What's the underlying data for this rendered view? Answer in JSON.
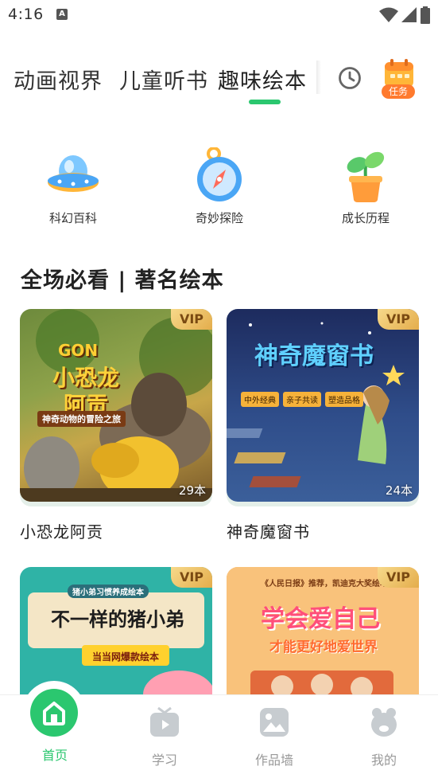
{
  "status_bar": {
    "time": "4:16",
    "notification_icon": "A"
  },
  "top_tabs": {
    "items": [
      {
        "label": "动画视界"
      },
      {
        "label": "儿童听书"
      },
      {
        "label": "趣味绘本"
      }
    ],
    "active_index": 2,
    "history_icon": "clock-icon",
    "task_label": "任务"
  },
  "categories": [
    {
      "label": "科幻百科",
      "icon": "ufo-icon"
    },
    {
      "label": "奇妙探险",
      "icon": "compass-icon"
    },
    {
      "label": "成长历程",
      "icon": "sprout-icon"
    }
  ],
  "section_title": "全场必看 | 著名绘本",
  "cards": [
    {
      "title": "小恐龙阿贡",
      "badge": "VIP",
      "count": "29本",
      "cover_title": "小恐龙阿贡",
      "cover_brand": "GON",
      "cover_sub": "神奇动物的冒险之旅"
    },
    {
      "title": "神奇魔窗书",
      "badge": "VIP",
      "count": "24本",
      "cover_title": "神奇魔窗书",
      "cover_tags": [
        "中外经典",
        "亲子共读",
        "塑造品格"
      ]
    },
    {
      "title": "",
      "badge": "VIP",
      "count": "",
      "cover_title": "不一样的猪小弟",
      "cover_top": "猪小弟习惯养成绘本",
      "cover_sub": "当当网爆款绘本"
    },
    {
      "title": "",
      "badge": "VIP",
      "count": "",
      "cover_title": "学会爱自己",
      "cover_top": "《人民日报》推荐，凯迪克大奖绘本",
      "cover_sub": "才能更好地爱世界"
    }
  ],
  "bottom_nav": [
    {
      "label": "首页",
      "icon": "home-icon",
      "active": true
    },
    {
      "label": "学习",
      "icon": "tv-icon",
      "active": false
    },
    {
      "label": "作品墙",
      "icon": "image-icon",
      "active": false
    },
    {
      "label": "我的",
      "icon": "bear-face-icon",
      "active": false
    }
  ],
  "colors": {
    "accent": "#2bc76f",
    "task": "#ff7a2e",
    "vip": "#e4ad4c"
  }
}
